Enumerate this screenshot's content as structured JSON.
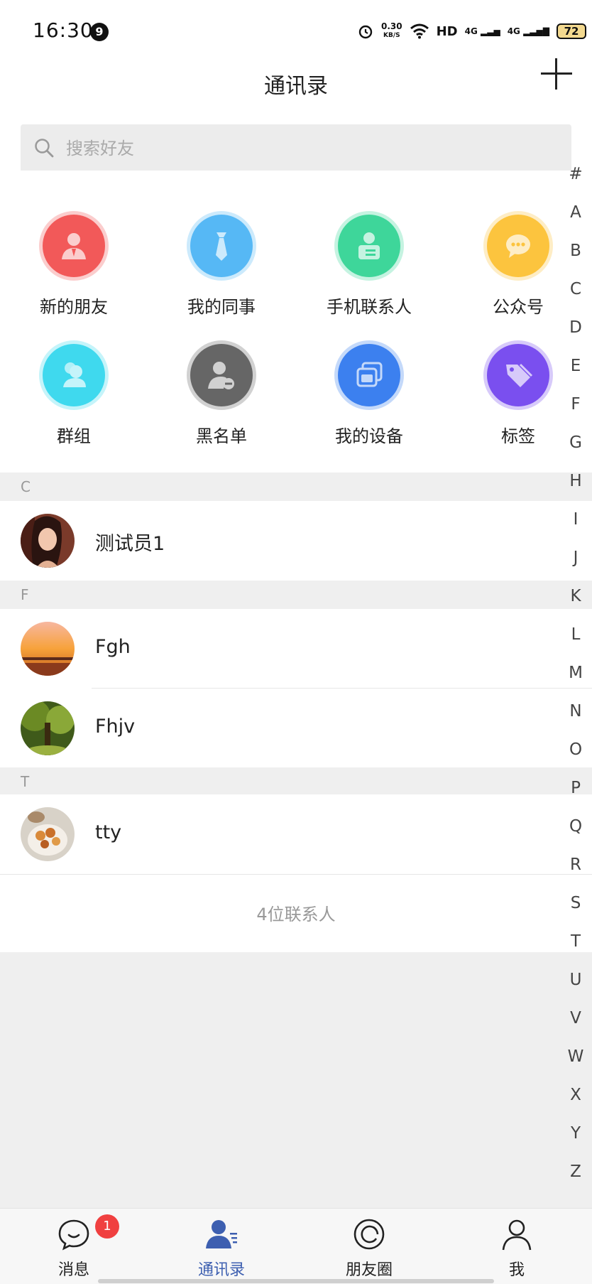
{
  "status_bar": {
    "time": "16:30",
    "notification_count": "9",
    "net_speed_value": "0.30",
    "net_speed_unit": "KB/S",
    "hd_label": "HD",
    "sim1_label": "4G",
    "sim2_label": "4G",
    "battery": "72"
  },
  "header": {
    "title": "通讯录"
  },
  "search": {
    "placeholder": "搜索好友"
  },
  "quick_actions": [
    {
      "label": "新的朋友",
      "icon": "new-friend-icon",
      "color": "#f25a5a"
    },
    {
      "label": "我的同事",
      "icon": "tie-icon",
      "color": "#57b8f5"
    },
    {
      "label": "手机联系人",
      "icon": "phone-contact-icon",
      "color": "#3ed69a"
    },
    {
      "label": "公众号",
      "icon": "chat-bubble-icon",
      "color": "#fcc43e"
    },
    {
      "label": "群组",
      "icon": "group-icon",
      "color": "#3fd9ee"
    },
    {
      "label": "黑名单",
      "icon": "blacklist-icon",
      "color": "#666666"
    },
    {
      "label": "我的设备",
      "icon": "devices-icon",
      "color": "#3d80f0"
    },
    {
      "label": "标签",
      "icon": "tag-icon",
      "color": "#7a4ff0"
    }
  ],
  "alphabet_index": [
    "#",
    "A",
    "B",
    "C",
    "D",
    "E",
    "F",
    "G",
    "H",
    "I",
    "J",
    "K",
    "L",
    "M",
    "N",
    "O",
    "P",
    "Q",
    "R",
    "S",
    "T",
    "U",
    "V",
    "W",
    "X",
    "Y",
    "Z"
  ],
  "sections": [
    {
      "letter": "C",
      "contacts": [
        {
          "name": "测试员1"
        }
      ]
    },
    {
      "letter": "F",
      "contacts": [
        {
          "name": "Fgh"
        },
        {
          "name": "Fhjv"
        }
      ]
    },
    {
      "letter": "T",
      "contacts": [
        {
          "name": "tty"
        }
      ]
    }
  ],
  "contact_count": "4位联系人",
  "tabs": [
    {
      "label": "消息",
      "icon": "message-icon",
      "badge": "1"
    },
    {
      "label": "通讯录",
      "icon": "contacts-icon",
      "active": true
    },
    {
      "label": "朋友圈",
      "icon": "moments-icon"
    },
    {
      "label": "我",
      "icon": "profile-icon"
    }
  ],
  "colors": {
    "accent": "#3d5fb0",
    "badge": "#f04040"
  }
}
